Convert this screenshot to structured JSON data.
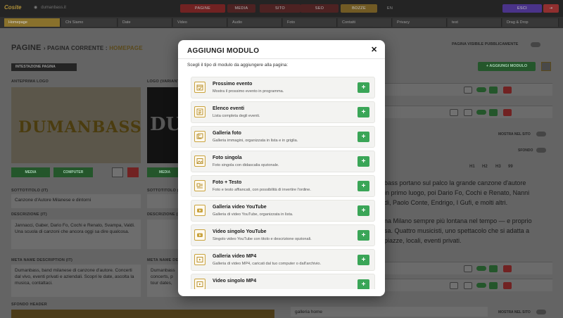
{
  "topbar": {
    "logo": "Cosite",
    "domain": "dumanbass.it",
    "nav": [
      "PAGINE",
      "MEDIA",
      "SITO",
      "SEO",
      "BOZZE",
      "EN"
    ],
    "logout": "ESCI"
  },
  "tabs": [
    "Homepage",
    "Chi Siamo",
    "Date",
    "Video",
    "Audio",
    "Foto",
    "Contatti",
    "Privacy",
    "test",
    "Drag & Drop"
  ],
  "page": {
    "title": "PAGINE",
    "subtitle": "PAGINA CORRENTE",
    "current": "HOMEPAGE",
    "visible_label": "PAGINA VISIBILE PUBBLICAMENTE",
    "intestazione": "INTESTAZIONE PAGINA",
    "add_module_btn": "+ AGGIUNGI MODULO",
    "anteprima_logo": "ANTEPRIMA LOGO",
    "logo_variant": "LOGO (VARIANTE",
    "logo_text": "DUMANBASS",
    "logo_text_short": "DU",
    "media_btn": "MEDIA",
    "computer_btn": "COMPUTER",
    "sottotitolo_label": "SOTTOTITOLO (IT)",
    "sottotitolo_value": "Canzone d'Autore Milanese e dintorni",
    "descrizione_label": "DESCRIZIONE (IT)",
    "descrizione_value": "Jannacci, Gaber, Dario Fo, Cochi e Renato, Svampa, Valdi. Una scuola di canzoni che ancora oggi sa dire qualcosa.",
    "meta_label": "META NAME DESCRIPTION (IT)",
    "meta_value": "Dumanbass, band milanese di canzone d'autore. Concerti dal vivo, eventi privati e aziendali. Scopri le date, ascolta la musica, contattaci.",
    "sottotitolo_label_en": "SOTTOTITOLO (EN",
    "descrizione_label_en": "DESCRIZIONE (EN",
    "meta_label_en": "META NAME DESC",
    "meta_value_en_1": "Dumanbass",
    "meta_value_en_2": "concerts, p",
    "meta_value_en_3": "tour dates, ",
    "sfondo_header": "SFONDO HEADER",
    "mostra_sito": "MOSTRA NEL SITO",
    "sfondo": "SFONDO",
    "galleria_home": "galleria home",
    "right_text_1": "bass portano sul palco la grande canzone d'autore",
    "right_text_2": "in primo luogo, poi Dario Fo, Cochi e Renato, Nanni",
    "right_text_3": "di, Paolo Conte, Endrigo, I Gufi, e molti altri.",
    "right_text_4": "na Milano sempre più lontana nel tempo — e proprio",
    "right_text_5": "sa. Quattro musicisti, uno spettacolo che si adatta a",
    "right_text_6": "piazze, locali, eventi privati.",
    "fmt_buttons": [
      "H1",
      "H2",
      "H3",
      "99"
    ]
  },
  "modal": {
    "title": "AGGIUNGI MODULO",
    "close": "✕",
    "subtitle": "Scegli il tipo di modulo da aggiungere alla pagina:",
    "add_label": "+",
    "items": [
      {
        "name": "Prossimo evento",
        "desc": "Mostra il prossimo evento in programma.",
        "icon": "calendar-check-icon"
      },
      {
        "name": "Elenco eventi",
        "desc": "Lista completa degli eventi.",
        "icon": "list-icon"
      },
      {
        "name": "Galleria foto",
        "desc": "Galleria immagini, organizzata in lista e in griglia.",
        "icon": "gallery-icon"
      },
      {
        "name": "Foto singola",
        "desc": "Foto singola con didascalia opzionale.",
        "icon": "image-icon"
      },
      {
        "name": "Foto + Testo",
        "desc": "Foto e testo affiancati, con possibilità di invertire l'ordine.",
        "icon": "image-text-icon"
      },
      {
        "name": "Galleria video YouTube",
        "desc": "Galleria di video YouTube, organizzata in lista.",
        "icon": "youtube-gallery-icon"
      },
      {
        "name": "Video singolo YouTube",
        "desc": "Singolo video YouTube con titolo e descrizione opzionali.",
        "icon": "youtube-icon"
      },
      {
        "name": "Galleria video MP4",
        "desc": "Galleria di video MP4, caricati dal tuo computer o dall'archivio.",
        "icon": "video-gallery-icon"
      },
      {
        "name": "Video singolo MP4",
        "desc": "",
        "icon": "video-icon"
      }
    ]
  },
  "colors": {
    "accent_gold": "#c9a33e",
    "add_green": "#3aa557",
    "danger_red": "#b03a3a"
  }
}
